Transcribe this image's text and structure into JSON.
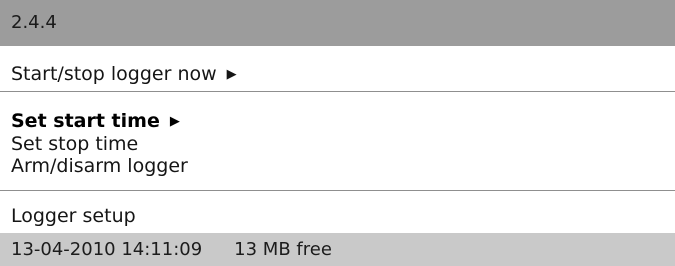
{
  "header": {
    "menu_path": "2.4.4"
  },
  "menu": {
    "items": [
      {
        "label": "Start/stop logger now",
        "icon": "submenu-arrow-icon",
        "selected": false
      },
      {
        "label": "Set start time",
        "icon": "submenu-arrow-icon",
        "selected": true
      },
      {
        "label": "Set stop time",
        "selected": false
      },
      {
        "label": "Arm/disarm logger",
        "selected": false
      },
      {
        "label": "Logger setup",
        "selected": false
      }
    ]
  },
  "status": {
    "datetime": "13-04-2010 14:11:09",
    "free_space": "13 MB free"
  },
  "colors": {
    "title_bar": "#9c9c9c",
    "status_bar": "#c9c9c9",
    "background": "#ffffff",
    "text": "#111111"
  }
}
